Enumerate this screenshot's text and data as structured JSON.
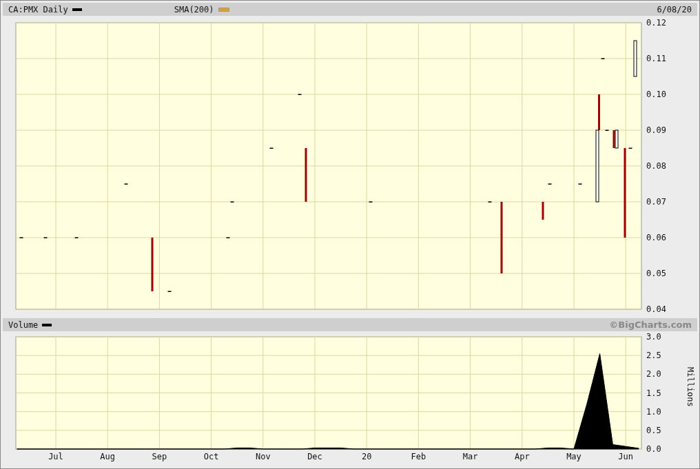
{
  "price_panel": {
    "symbol_label": "CA:PMX Daily",
    "indicator_label": "SMA(200)",
    "date": "6/08/20",
    "y_axis_labels": [
      "0.12",
      "0.11",
      "0.10",
      "0.09",
      "0.08",
      "0.07",
      "0.06",
      "0.05",
      "0.04"
    ]
  },
  "volume_panel": {
    "label": "Volume",
    "credit": "©BigCharts.com",
    "chart_data": {
      "type": "area",
      "grid": true,
      "ylabel": "Millions",
      "ylim": [
        0,
        3
      ],
      "yticks": [
        {
          "value": 0,
          "label": "0.0"
        },
        {
          "value": 0.5,
          "label": "0.5"
        },
        {
          "value": 1,
          "label": "1.0"
        },
        {
          "value": 1.5,
          "label": "1.5"
        },
        {
          "value": 2,
          "label": "2.0"
        },
        {
          "value": 2.5,
          "label": "2.5"
        },
        {
          "value": 3,
          "label": "3.0"
        }
      ],
      "categories": [
        null,
        null,
        null,
        "Jul",
        null,
        null,
        null,
        "Aug",
        null,
        null,
        null,
        "Sep",
        null,
        null,
        null,
        "Oct",
        null,
        null,
        null,
        "Nov",
        null,
        null,
        null,
        "Dec",
        null,
        null,
        null,
        "20",
        null,
        null,
        null,
        "Feb",
        null,
        null,
        null,
        "Mar",
        null,
        null,
        null,
        "Apr",
        null,
        null,
        null,
        "May",
        null,
        null,
        null,
        "Jun",
        null
      ],
      "values": [
        0,
        0,
        0,
        0,
        0,
        0,
        0,
        0,
        0,
        0,
        0,
        0,
        0,
        0,
        0,
        0,
        0,
        0.03,
        0.03,
        0,
        0,
        0,
        0,
        0.03,
        0.03,
        0.03,
        0,
        0,
        0,
        0,
        0,
        0,
        0,
        0,
        0,
        0,
        0,
        0,
        0,
        0,
        0,
        0.03,
        0.03,
        0,
        1.2,
        2.55,
        0.12,
        0.07,
        0.02
      ]
    }
  }
}
